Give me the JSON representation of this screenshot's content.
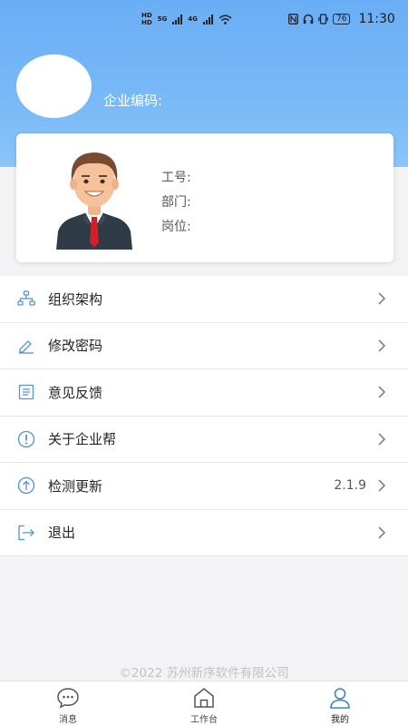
{
  "status_bar": {
    "hd_top": "HD",
    "hd_bottom": "HD",
    "net_5g": "5G",
    "net_4g": "4G",
    "battery": "76",
    "time": "11:30"
  },
  "header": {
    "company_code_label": "企业编码:"
  },
  "profile": {
    "employee_id_label": "工号:",
    "department_label": "部门:",
    "position_label": "岗位:"
  },
  "menu": {
    "items": [
      {
        "label": "组织架构",
        "icon": "org-structure-icon"
      },
      {
        "label": "修改密码",
        "icon": "pencil-icon"
      },
      {
        "label": "意见反馈",
        "icon": "document-icon"
      },
      {
        "label": "关于企业帮",
        "icon": "info-icon"
      },
      {
        "label": "检测更新",
        "icon": "upload-icon",
        "value": "2.1.9"
      },
      {
        "label": "退出",
        "icon": "logout-icon"
      }
    ]
  },
  "footer": {
    "copyright": "©2022 苏州新序软件有限公司"
  },
  "tabbar": {
    "tabs": [
      {
        "label": "消息",
        "icon": "chat-icon"
      },
      {
        "label": "工作台",
        "icon": "home-icon"
      },
      {
        "label": "我的",
        "icon": "user-icon",
        "active": true
      }
    ]
  },
  "colors": {
    "header_blue": "#6aaef5",
    "icon_blue": "#4f93d8"
  }
}
